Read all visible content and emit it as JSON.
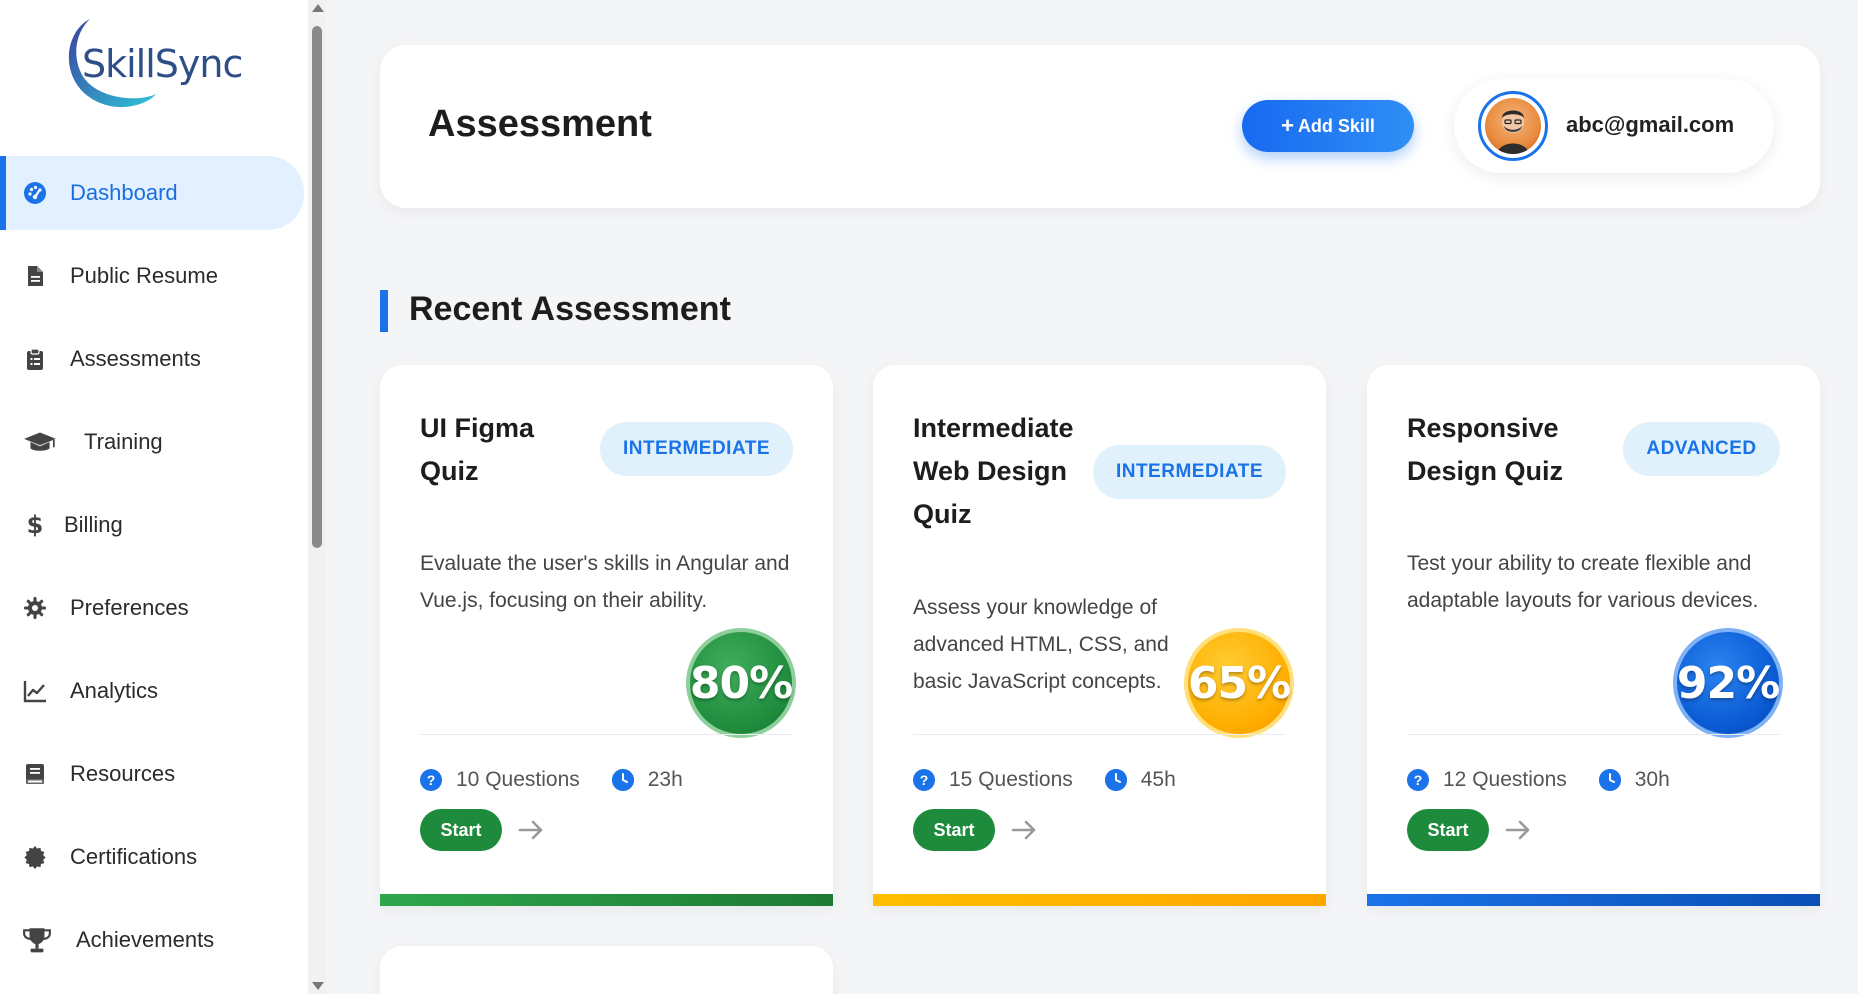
{
  "logo": {
    "text": "SkillSync"
  },
  "sidebar": {
    "items": [
      {
        "label": "Dashboard",
        "icon": "dashboard-gauge-icon",
        "active": true
      },
      {
        "label": "Public Resume",
        "icon": "document-icon",
        "active": false
      },
      {
        "label": "Assessments",
        "icon": "clipboard-icon",
        "active": false
      },
      {
        "label": "Training",
        "icon": "graduation-cap-icon",
        "active": false
      },
      {
        "label": "Billing",
        "icon": "dollar-icon",
        "active": false
      },
      {
        "label": "Preferences",
        "icon": "gear-icon",
        "active": false
      },
      {
        "label": "Analytics",
        "icon": "line-chart-icon",
        "active": false
      },
      {
        "label": "Resources",
        "icon": "book-icon",
        "active": false
      },
      {
        "label": "Certifications",
        "icon": "certificate-icon",
        "active": false
      },
      {
        "label": "Achievements",
        "icon": "trophy-icon",
        "active": false
      }
    ]
  },
  "header": {
    "title": "Assessment",
    "add_skill_plus": "+",
    "add_skill_label": "Add Skill",
    "user_email": "abc@gmail.com"
  },
  "section": {
    "title": "Recent Assessment"
  },
  "cards": [
    {
      "title_lines": [
        "UI Figma",
        "Quiz"
      ],
      "level": "INTERMEDIATE",
      "description": "Evaluate the user's skills in Angular and Vue.js, focusing on their ability.",
      "score": "80%",
      "questions": "10 Questions",
      "duration": "23h",
      "start_label": "Start",
      "color": "#1e8a3c"
    },
    {
      "title_lines": [
        "Intermediate",
        "Web Design",
        "Quiz"
      ],
      "level": "INTERMEDIATE",
      "description": "Assess your knowledge of advanced HTML, CSS, and basic JavaScript concepts.",
      "score": "65%",
      "questions": "15 Questions",
      "duration": "45h",
      "start_label": "Start",
      "color": "#ffae00"
    },
    {
      "title_lines": [
        "Responsive",
        "Design Quiz"
      ],
      "level": "ADVANCED",
      "description": "Test your ability to create flexible and adaptable layouts for various devices.",
      "score": "92%",
      "questions": "12 Questions",
      "duration": "30h",
      "start_label": "Start",
      "color": "#0a5bd3"
    }
  ],
  "meta_icons": {
    "questions": "?"
  },
  "colors": {
    "accent": "#1a73e8",
    "success": "#1e8a3c",
    "warning": "#ffae00",
    "badge_bg": "#e0f1fb"
  }
}
